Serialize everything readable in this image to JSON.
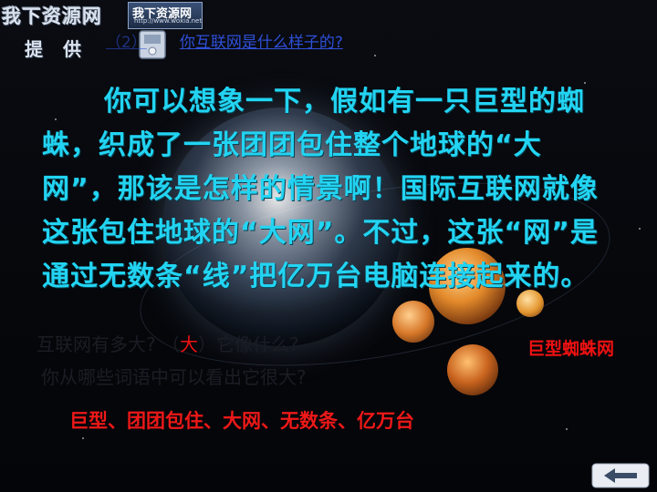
{
  "logo": {
    "title": "我下资源网",
    "subtitle": "提供",
    "badge_title": "我下资源网",
    "badge_url": "http://www.woxia.net"
  },
  "question": {
    "prefix": "（2）",
    "text": "你互联网是什么样子的?"
  },
  "body": {
    "paragraph": "你可以想象一下，假如有一只巨型的蜘蛛，织成了一张团团包住整个地球的“大网”，那该是怎样的情景啊！国际互联网就像这张包住地球的“大网”。不过，这张“网”是通过无数条“线”把亿万台电脑连接起来的。"
  },
  "q2": {
    "before": "互联网有多大? （",
    "answer": "大",
    "after": "）它像什么?"
  },
  "q3": {
    "text": "你从哪些词语中可以看出它很大?"
  },
  "answer_red": "巨型蜘蛛网",
  "keywords": "巨型、团团包住、大网、无数条、亿万台",
  "icons": {
    "disk": "disk-icon",
    "back": "back-arrow-icon"
  },
  "colors": {
    "body_text": "#22d4f2",
    "link": "#2f4fd8",
    "answer": "#ee1818"
  }
}
